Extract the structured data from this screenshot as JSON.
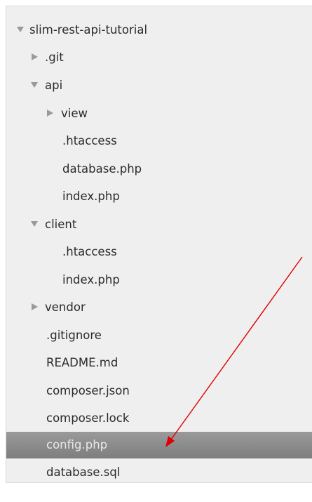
{
  "tree": {
    "root": {
      "label": "slim-rest-api-tutorial",
      "icon": "triangle-down-icon"
    },
    "git": {
      "label": ".git",
      "icon": "triangle-right-icon"
    },
    "api": {
      "label": "api",
      "icon": "triangle-down-icon"
    },
    "api_view": {
      "label": "view",
      "icon": "triangle-right-icon"
    },
    "api_htaccess": {
      "label": ".htaccess"
    },
    "api_database": {
      "label": "database.php"
    },
    "api_index": {
      "label": "index.php"
    },
    "client": {
      "label": "client",
      "icon": "triangle-down-icon"
    },
    "client_htaccess": {
      "label": ".htaccess"
    },
    "client_index": {
      "label": "index.php"
    },
    "vendor": {
      "label": "vendor",
      "icon": "triangle-right-icon"
    },
    "gitignore": {
      "label": ".gitignore"
    },
    "readme": {
      "label": "README.md"
    },
    "composer_json": {
      "label": "composer.json"
    },
    "composer_lock": {
      "label": "composer.lock"
    },
    "config": {
      "label": "config.php",
      "selected": true
    },
    "database_sql": {
      "label": "database.sql"
    }
  },
  "colors": {
    "panel_bg": "#efefef",
    "text": "#2b2b2b",
    "selected_bg": "#8a8a8a",
    "selected_text": "#e8e8e8",
    "disclosure": "#9a9a9a",
    "annotation_arrow": "#e00000"
  }
}
